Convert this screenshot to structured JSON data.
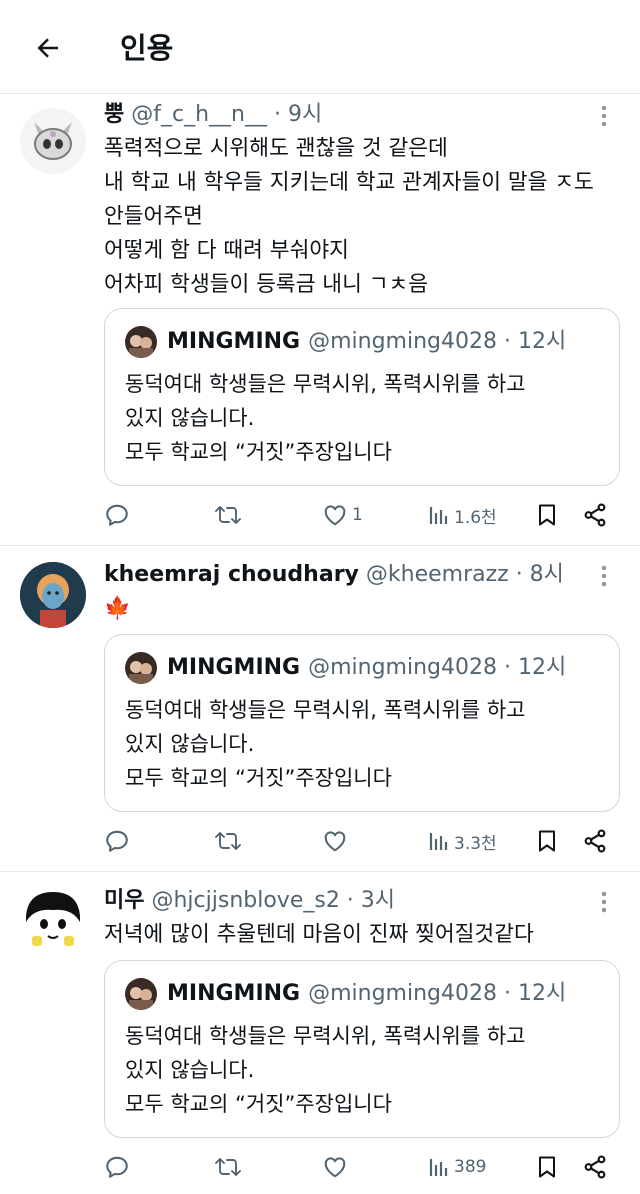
{
  "header": {
    "title": "인용",
    "back_icon": "arrow-left-icon"
  },
  "quoted": {
    "name": "MINGMING",
    "meta": "@mingming4028 · 12시",
    "lines": [
      "동덕여대 학생들은 무력시위, 폭력시위를 하고",
      "있지 않습니다.",
      "모두 학교의 “거짓”주장입니다"
    ]
  },
  "tweets": [
    {
      "name": "뿡",
      "meta": "@f_c_h__n__ · 9시",
      "lines": [
        "폭력적으로 시위해도 괜찮을 것 같은데",
        "내 학교 내 학우들 지키는데 학교 관계자들이 말을 ㅈ도",
        "안들어주면",
        "어떻게 함 다 때려 부숴야지",
        "어차피 학생들이 등록금 내니 ㄱㅊ음"
      ],
      "stats": {
        "replies": "",
        "retweets": "",
        "likes": "1",
        "views": "1.6천"
      }
    },
    {
      "name": "kheemraj choudhary",
      "meta": "@kheemrazz · 8시",
      "lines": [
        "🍁"
      ],
      "stats": {
        "replies": "",
        "retweets": "",
        "likes": "",
        "views": "3.3천"
      }
    },
    {
      "name": "미우",
      "meta": "@hjcjjsnblove_s2 · 3시",
      "lines": [
        "저녁에 많이 추울텐데 마음이 진짜 찢어질것같다"
      ],
      "stats": {
        "replies": "",
        "retweets": "",
        "likes": "",
        "views": "389"
      }
    }
  ],
  "icons": [
    "reply-icon",
    "retweet-icon",
    "like-icon",
    "views-icon",
    "bookmark-icon",
    "share-icon",
    "more-icon"
  ],
  "colors": {
    "text": "#0f1419",
    "secondary": "#536471",
    "border": "#cfd9de",
    "divider": "#e6e9ec"
  }
}
